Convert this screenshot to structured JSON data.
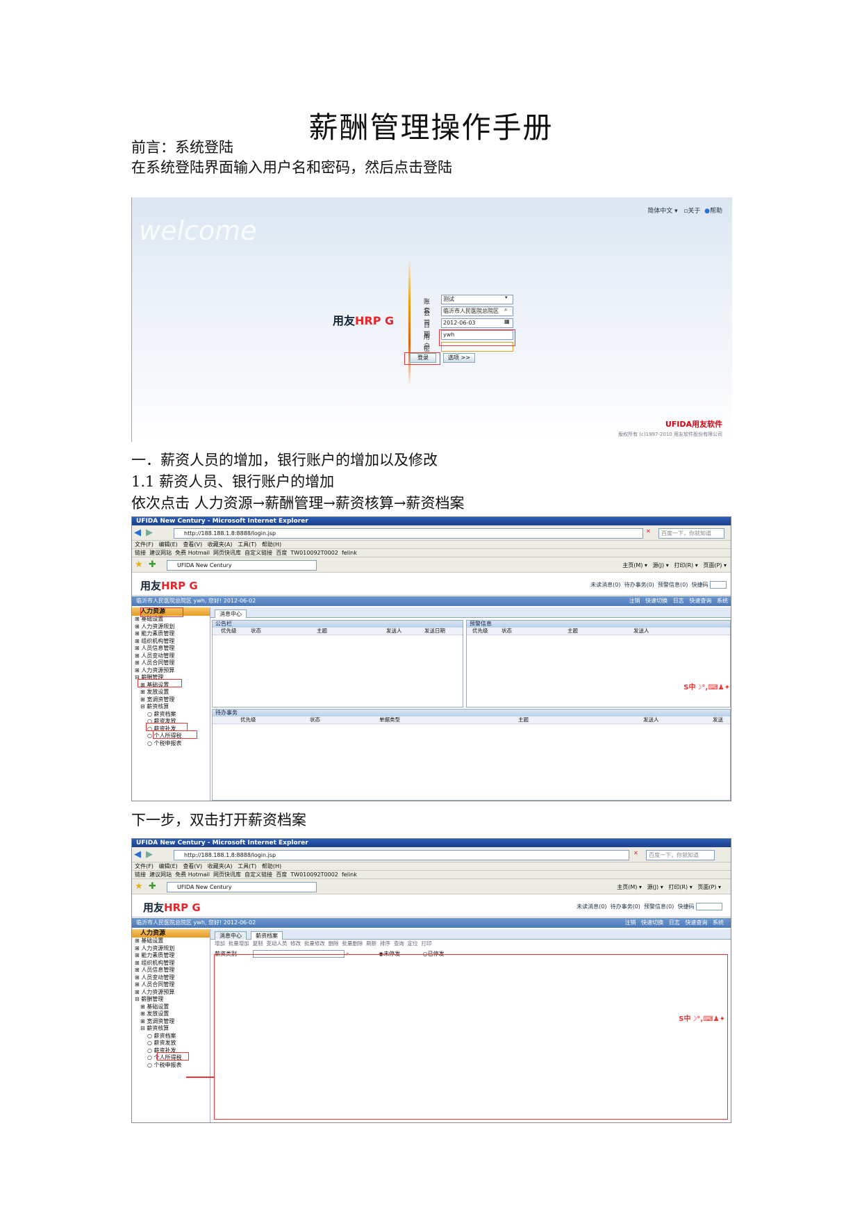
{
  "doc": {
    "title": "薪酬管理操作手册",
    "preface": "前言：系统登陆",
    "login_instruction": "在系统登陆界面输入用户名和密码，然后点击登陆",
    "section1": "一．薪资人员的增加，银行账户的增加以及修改",
    "section1_1": "1.1  薪资人员、银行账户的增加",
    "nav_path": "依次点击  人力资源→薪酬管理→薪资核算→薪资档案",
    "next_step": "下一步，双击打开薪资档案"
  },
  "login": {
    "welcome": "welcome",
    "lang": "简体中文 ▾",
    "about": "关于",
    "help": "帮助",
    "logo_a": "用友",
    "logo_b": "HRP G",
    "fields": [
      {
        "label": "账套",
        "value": "测试"
      },
      {
        "label": "公司",
        "value": "临沂市人民医院总院区"
      },
      {
        "label": "日期",
        "value": "2012-06-03"
      },
      {
        "label": "用户",
        "value": "ywh"
      },
      {
        "label": "密码",
        "value": ""
      }
    ],
    "login_button": "登录",
    "options_button": "选项 >>",
    "brand": "UFIDA用友软件",
    "copyright": "版权所有 (c)1997-2010 用友软件股份有限公司"
  },
  "ie": {
    "window_title": "UFIDA New Century - Microsoft Internet Explorer",
    "url": "http://188.188.1.8:8888/login.jsp",
    "search_placeholder": "百度一下，你就知道",
    "menu": [
      "文件(F)",
      "编辑(E)",
      "查看(V)",
      "收藏夹(A)",
      "工具(T)",
      "帮助(H)"
    ],
    "links_label": "链接",
    "links": [
      "建议网站",
      "免费 Hotmail",
      "网页快讯库",
      "自定义链接",
      "百度",
      "TW010092T0002",
      "felink"
    ],
    "tab_title": "UFIDA New Century",
    "right_tools": [
      "主页(M)",
      "源(J)",
      "打印(R)",
      "页面(P)"
    ]
  },
  "app": {
    "logo_a": "用友",
    "logo_b": "HRP G",
    "top_links": [
      "未读消息(0)",
      "待办事务(0)",
      "预警信息(0)",
      "快捷码"
    ],
    "user_info": "临沂市人民医院总院区 ywh, 您好! 2012-06-02",
    "strip_tools": [
      "注销",
      "快速切换",
      "日志",
      "快速查询",
      "系统"
    ],
    "left_head": "人力资源",
    "tree": [
      "⊞ 基础设置",
      "⊞ 人力资源规划",
      "⊞ 能力素质管理",
      "⊞ 组织机构管理",
      "⊞ 人员信息管理",
      "⊞ 人员变动管理",
      "⊞ 人员合同管理",
      "⊞ 人力资源预算",
      "⊟ 薪酬管理",
      "  ⊞ 基础设置",
      "  ⊞ 发放设置",
      "  ⊞ 宽调资管理",
      "  ⊟ 薪资核算",
      "    ○ 薪资档案",
      "    ○ 薪资发放",
      "    ○ 薪资补发",
      "    ○ 个人所得税",
      "    ○ 个税申报表"
    ],
    "tab_message": "消息中心",
    "tab_archive": "薪资档案",
    "announce": "公告栏",
    "announce_cols": [
      "优先级",
      "状态",
      "主题",
      "发送人",
      "发送日期"
    ],
    "alert": "预警信息",
    "alert_cols": [
      "优先级",
      "状态",
      "主题",
      "发送人"
    ],
    "todo": "待办事务",
    "todo_cols": [
      "优先级",
      "状态",
      "单据类型",
      "主题",
      "发送人",
      "发送"
    ],
    "archive_toolbar": [
      "增加",
      "批量增加",
      "复制",
      "变动人员",
      "修改",
      "批量修改",
      "删除",
      "批量删除",
      "刷新",
      "排序",
      "查询",
      "定位",
      "打印"
    ],
    "archive_type_label": "薪资类别",
    "radio_unstop": "未停发",
    "radio_stopped": "已停发",
    "ime": "S中☽°,⌨♟✦"
  }
}
